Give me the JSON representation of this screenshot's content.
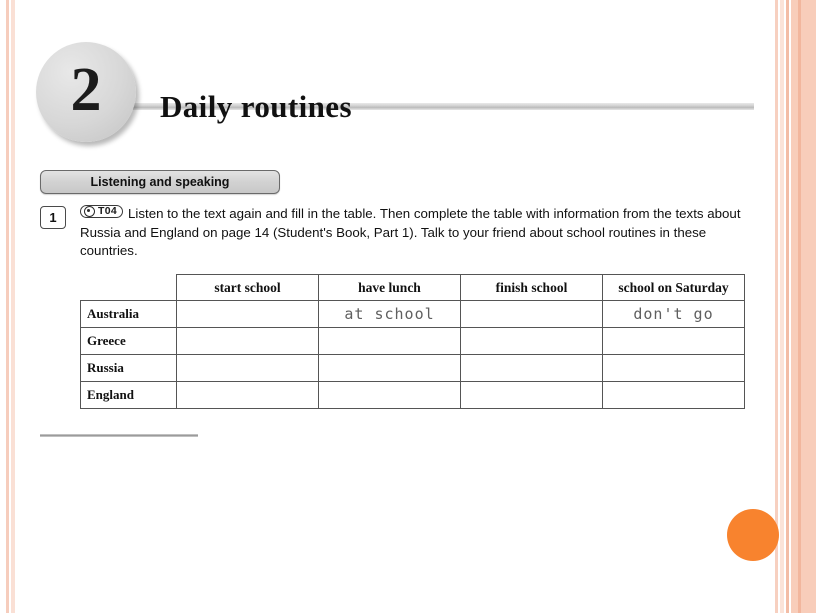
{
  "page": {
    "unit_number": "2",
    "title": "Daily routines",
    "accent_orange": "#f8832e",
    "stripe_peach": "#f8cdba",
    "rule_gray": "#b9b9b9"
  },
  "section": {
    "banner_label": "Listening and speaking"
  },
  "exercise": {
    "number": "1",
    "audio_icon": "audio-disc-icon",
    "audio_track": "T04",
    "instructions": "Listen to the text again and fill in the table. Then complete the table with information from the texts about Russia and England on page 14 (Student's Book, Part 1). Talk to your friend about school routines in these countries."
  },
  "table": {
    "corner_label": "",
    "columns": [
      "start school",
      "have lunch",
      "finish school",
      "school on Saturday"
    ],
    "rows": [
      {
        "label": "Australia",
        "cells": [
          "",
          "at school",
          "",
          "don't go"
        ]
      },
      {
        "label": "Greece",
        "cells": [
          "",
          "",
          "",
          ""
        ]
      },
      {
        "label": "Russia",
        "cells": [
          "",
          "",
          "",
          ""
        ]
      },
      {
        "label": "England",
        "cells": [
          "",
          "",
          "",
          ""
        ]
      }
    ]
  }
}
